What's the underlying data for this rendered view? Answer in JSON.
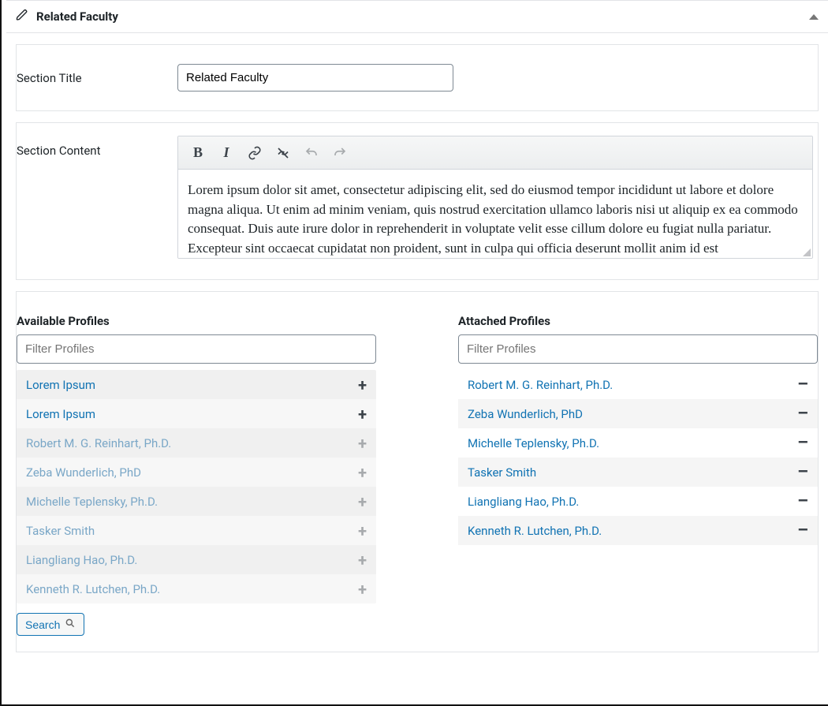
{
  "panel": {
    "title": "Related Faculty"
  },
  "section_title": {
    "label": "Section Title",
    "value": "Related Faculty"
  },
  "section_content": {
    "label": "Section Content",
    "body": "Lorem ipsum dolor sit amet, consectetur adipiscing elit, sed do eiusmod tempor incididunt ut labore et dolore magna aliqua. Ut enim ad minim veniam, quis nostrud exercitation ullamco laboris nisi ut aliquip ex ea commodo consequat. Duis aute irure dolor in reprehenderit in voluptate velit esse cillum dolore eu fugiat nulla pariatur. Excepteur sint occaecat cupidatat non proident, sunt in culpa qui officia deserunt mollit anim id est"
  },
  "profiles": {
    "available": {
      "heading": "Available Profiles",
      "filter_placeholder": "Filter Profiles",
      "search_label": "Search",
      "items": [
        {
          "name": "Lorem Ipsum",
          "dim": false
        },
        {
          "name": "Lorem Ipsum",
          "dim": false
        },
        {
          "name": "Robert M. G. Reinhart, Ph.D.",
          "dim": true
        },
        {
          "name": "Zeba Wunderlich, PhD",
          "dim": true
        },
        {
          "name": "Michelle Teplensky, Ph.D.",
          "dim": true
        },
        {
          "name": "Tasker Smith",
          "dim": true
        },
        {
          "name": "Liangliang Hao, Ph.D.",
          "dim": true
        },
        {
          "name": "Kenneth R. Lutchen, Ph.D.",
          "dim": true
        }
      ]
    },
    "attached": {
      "heading": "Attached Profiles",
      "filter_placeholder": "Filter Profiles",
      "items": [
        {
          "name": "Robert M. G. Reinhart, Ph.D."
        },
        {
          "name": "Zeba Wunderlich, PhD"
        },
        {
          "name": "Michelle Teplensky, Ph.D."
        },
        {
          "name": "Tasker Smith"
        },
        {
          "name": "Liangliang Hao, Ph.D."
        },
        {
          "name": "Kenneth R. Lutchen, Ph.D."
        }
      ]
    }
  }
}
